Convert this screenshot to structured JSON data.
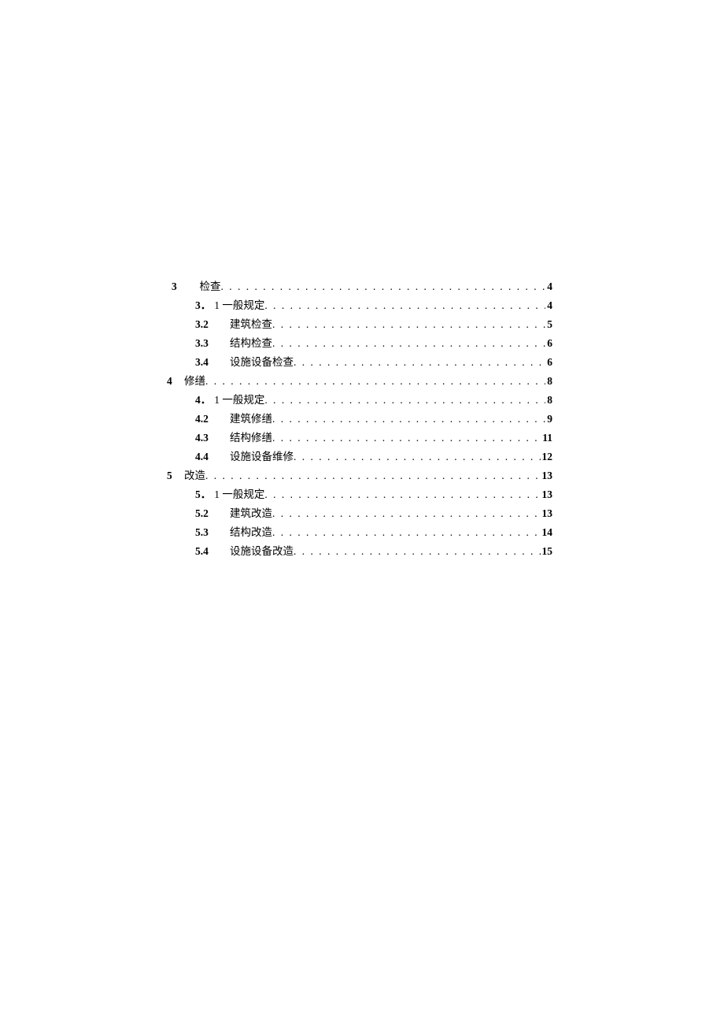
{
  "toc": [
    {
      "level": 1,
      "num": "3",
      "title": "检查",
      "page": "4",
      "sub1": false,
      "neg": 0
    },
    {
      "level": 2,
      "num": "3．",
      "title": "1 一般规定",
      "page": "4",
      "sub1": true,
      "neg": 0
    },
    {
      "level": 2,
      "num": "3.2",
      "title": "建筑检查",
      "page": "5",
      "sub1": false,
      "neg": 0
    },
    {
      "level": 2,
      "num": "3.3",
      "title": "结构检查",
      "page": "6",
      "sub1": false,
      "neg": 0
    },
    {
      "level": 2,
      "num": "3.4",
      "title": "设施设备检查",
      "page": "6",
      "sub1": false,
      "neg": 0
    },
    {
      "level": 1,
      "num": "4",
      "title": "修缮",
      "page": "8",
      "sub1": false,
      "neg": -6
    },
    {
      "level": 2,
      "num": "4．",
      "title": "1 一般规定",
      "page": "8",
      "sub1": true,
      "neg": 0
    },
    {
      "level": 2,
      "num": "4.2",
      "title": "建筑修缮",
      "page": "9",
      "sub1": false,
      "neg": 0
    },
    {
      "level": 2,
      "num": "4.3",
      "title": "结构修缮",
      "page": "11",
      "sub1": false,
      "neg": 0
    },
    {
      "level": 2,
      "num": "4.4",
      "title": "设施设备维修",
      "page": "12",
      "sub1": false,
      "neg": 0
    },
    {
      "level": 1,
      "num": "5",
      "title": "改造",
      "page": "13",
      "sub1": false,
      "neg": -6
    },
    {
      "level": 2,
      "num": "5．",
      "title": "1 一般规定",
      "page": "13",
      "sub1": true,
      "neg": 0
    },
    {
      "level": 2,
      "num": "5.2",
      "title": "建筑改造",
      "page": "13",
      "sub1": false,
      "neg": 0
    },
    {
      "level": 2,
      "num": "5.3",
      "title": "结构改造",
      "page": "14",
      "sub1": false,
      "neg": 0
    },
    {
      "level": 2,
      "num": "5.4",
      "title": "设施设备改造",
      "page": "15",
      "sub1": false,
      "neg": 0
    }
  ]
}
